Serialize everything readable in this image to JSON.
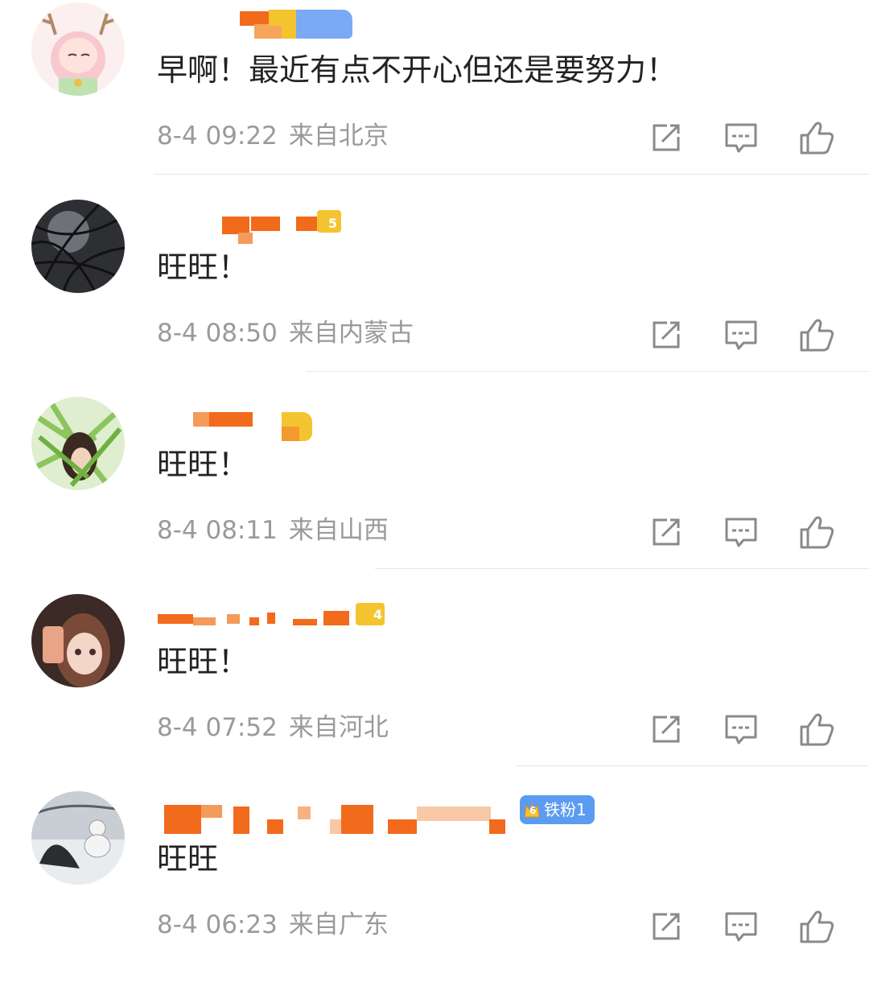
{
  "comments": [
    {
      "text": "早啊！最近有点不开心但还是要努力！",
      "time": "8-4 09:22",
      "location": "来自北京",
      "avatar": "anime-girl-antlers-avatar"
    },
    {
      "text": "旺旺！",
      "time": "8-4 08:50",
      "location": "来自内蒙古",
      "avatar": "dark-branches-avatar",
      "badge_level": "5"
    },
    {
      "text": "旺旺！",
      "time": "8-4 08:11",
      "location": "来自山西",
      "avatar": "girl-in-leaves-avatar"
    },
    {
      "text": "旺旺！",
      "time": "8-4 07:52",
      "location": "来自河北",
      "avatar": "girl-with-phone-avatar",
      "badge_level": "4"
    },
    {
      "text": "旺旺",
      "time": "8-4 06:23",
      "location": "来自广东",
      "avatar": "snowman-photo-avatar",
      "badge_level": "6",
      "fan_badge": "铁粉1"
    }
  ],
  "icons": {
    "repost": "repost-icon",
    "reply": "reply-icon",
    "like": "like-icon"
  },
  "colors": {
    "username_mosaic": "#f26a1b",
    "username_mosaic_light": "#f7b27f",
    "vip_blue": "#5b9cf0",
    "vip_gold": "#f4c430",
    "meta_text": "#9a9a9a",
    "body_text": "#222222"
  }
}
